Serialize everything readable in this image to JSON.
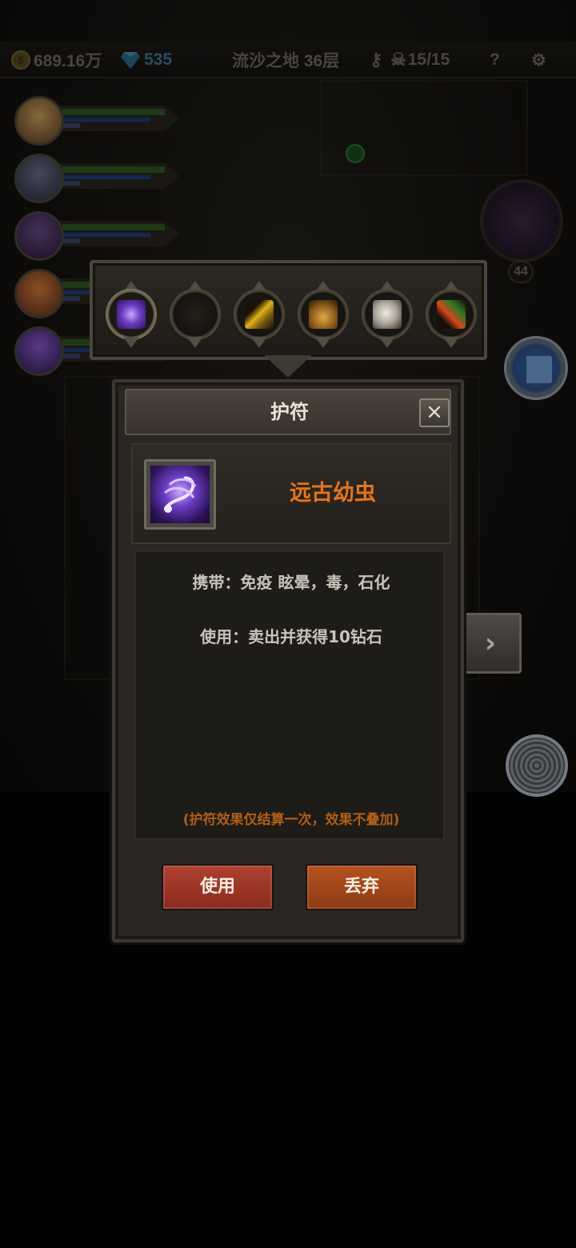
{
  "topbar": {
    "gold": "689.16万",
    "diamonds": "535",
    "location": "流沙之地 36层",
    "kills": "15/15",
    "help_label": "?"
  },
  "boss": {
    "level": "44"
  },
  "amulet_bar": {
    "slots": [
      {
        "name": "ancient-larva",
        "selected": true,
        "color": "#7a3fd6"
      },
      {
        "name": "empty",
        "selected": false,
        "color": ""
      },
      {
        "name": "golden-feather",
        "selected": false,
        "color": "#e0b21a"
      },
      {
        "name": "bell",
        "selected": false,
        "color": "#c8892a"
      },
      {
        "name": "horse-head",
        "selected": false,
        "color": "#d8d2c8"
      },
      {
        "name": "carrot",
        "selected": false,
        "color": "#d8451c"
      }
    ]
  },
  "dialog": {
    "title": "护符",
    "close_label": "×",
    "item_name": "远古幼虫",
    "carry_effect": "携带：免疫 眩晕，毒，石化",
    "use_effect": "使用：卖出并获得10钻石",
    "note": "(护符效果仅结算一次，效果不叠加)",
    "use_button": "使用",
    "discard_button": "丢弃"
  },
  "side": {
    "next_label": "›"
  },
  "colors": {
    "item_name": "#e6731b",
    "note": "#b25d16",
    "use_button": "#a33a2a",
    "discard_button": "#a3481a"
  }
}
